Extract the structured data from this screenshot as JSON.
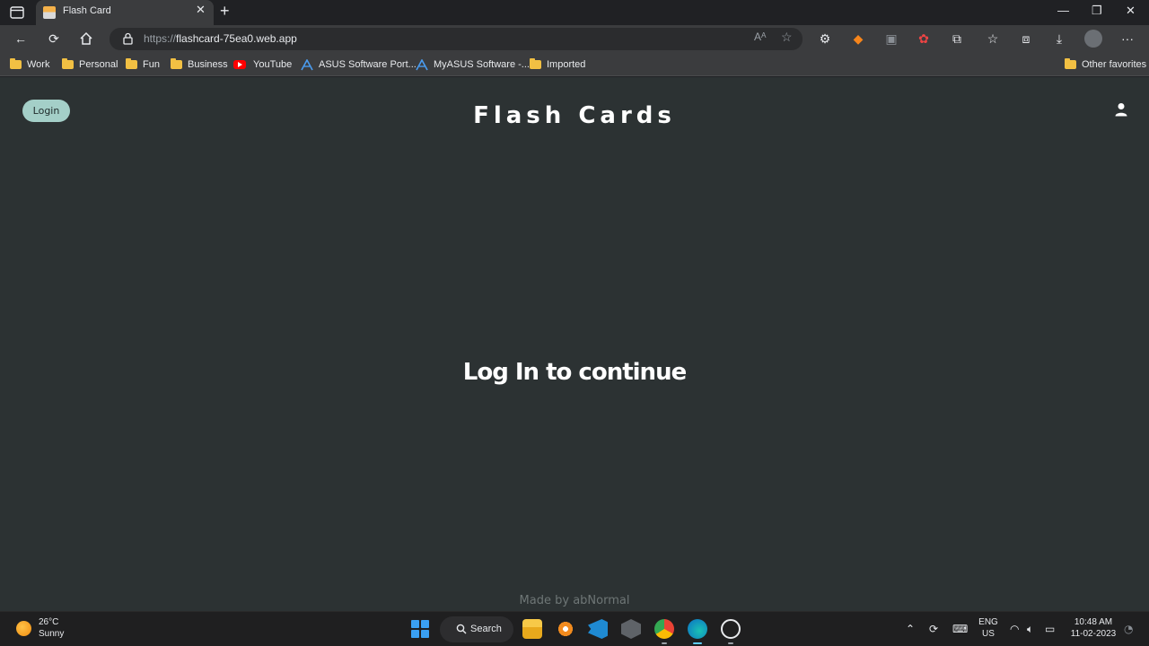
{
  "browser": {
    "tab": {
      "title": "Flash Card"
    },
    "url": {
      "protocol": "https://",
      "host": "flashcard-75ea0.web.app"
    },
    "bookmarks": [
      {
        "label": "Work",
        "type": "folder"
      },
      {
        "label": "Personal",
        "type": "folder"
      },
      {
        "label": "Fun",
        "type": "folder"
      },
      {
        "label": "Business",
        "type": "folder"
      },
      {
        "label": "YouTube",
        "type": "youtube"
      },
      {
        "label": "ASUS Software Port...",
        "type": "asus"
      },
      {
        "label": "MyASUS Software -...",
        "type": "asus"
      },
      {
        "label": "Imported",
        "type": "folder"
      }
    ],
    "other_favorites": "Other favorites"
  },
  "page": {
    "login_button": "Login",
    "title": "Flash Cards",
    "message": "Log In to continue",
    "footer": "Made by abNormal"
  },
  "taskbar": {
    "weather": {
      "temp": "26°C",
      "desc": "Sunny"
    },
    "search_label": "Search",
    "lang": {
      "line1": "ENG",
      "line2": "US"
    },
    "clock": {
      "time": "10:48 AM",
      "date": "11-02-2023"
    }
  },
  "colors": {
    "page_bg": "#2c3233",
    "login_button_bg": "#a4cfc8",
    "footer_text": "#6e7676"
  }
}
